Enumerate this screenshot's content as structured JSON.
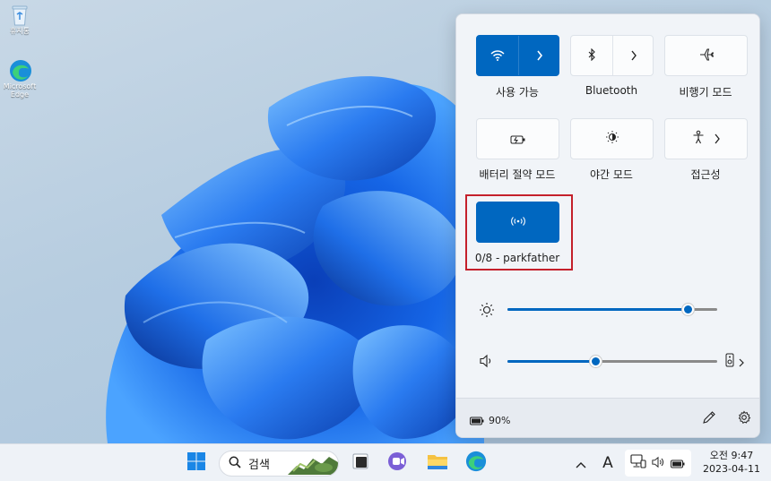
{
  "desktop": {
    "icons": [
      {
        "label": "휴지통",
        "icon": "recycle-bin-icon"
      },
      {
        "label": "Microsoft Edge",
        "icon": "edge-icon"
      }
    ]
  },
  "quick_settings": {
    "tiles": [
      {
        "label": "사용 가능",
        "icon": "wifi-icon",
        "active": true,
        "expand": true
      },
      {
        "label": "Bluetooth",
        "icon": "bluetooth-icon",
        "active": false,
        "expand": true
      },
      {
        "label": "비행기 모드",
        "icon": "airplane-icon",
        "active": false,
        "expand": false
      },
      {
        "label": "배터리 절약 모드",
        "icon": "battery-saver-icon",
        "active": false,
        "expand": false
      },
      {
        "label": "야간 모드",
        "icon": "night-light-icon",
        "active": false,
        "expand": false
      },
      {
        "label": "접근성",
        "icon": "accessibility-icon",
        "active": false,
        "expand": true
      },
      {
        "label": "0/8 - parkfather",
        "icon": "mobile-hotspot-icon",
        "active": true,
        "expand": false
      }
    ],
    "brightness": {
      "icon": "brightness-icon",
      "level": 0.86
    },
    "volume": {
      "icon": "speaker-icon",
      "level": 0.42,
      "output_icon": "audio-device-icon"
    },
    "footer": {
      "battery_icon": "battery-icon",
      "battery_text": "90%",
      "edit_icon": "pencil-icon",
      "settings_icon": "gear-icon"
    },
    "accent": "#0067c0"
  },
  "taskbar": {
    "search_placeholder": "검색",
    "apps": [
      "start-icon",
      "task-view-icon",
      "teams-chat-icon",
      "file-explorer-icon",
      "edge-icon"
    ],
    "tray": {
      "overflow_icon": "chevron-up-icon",
      "ime_label": "A",
      "network_icon": "network-icon",
      "volume_icon": "speaker-icon",
      "battery_icon": "battery-icon"
    },
    "clock": {
      "time": "오전 9:47",
      "date": "2023-04-11"
    }
  }
}
